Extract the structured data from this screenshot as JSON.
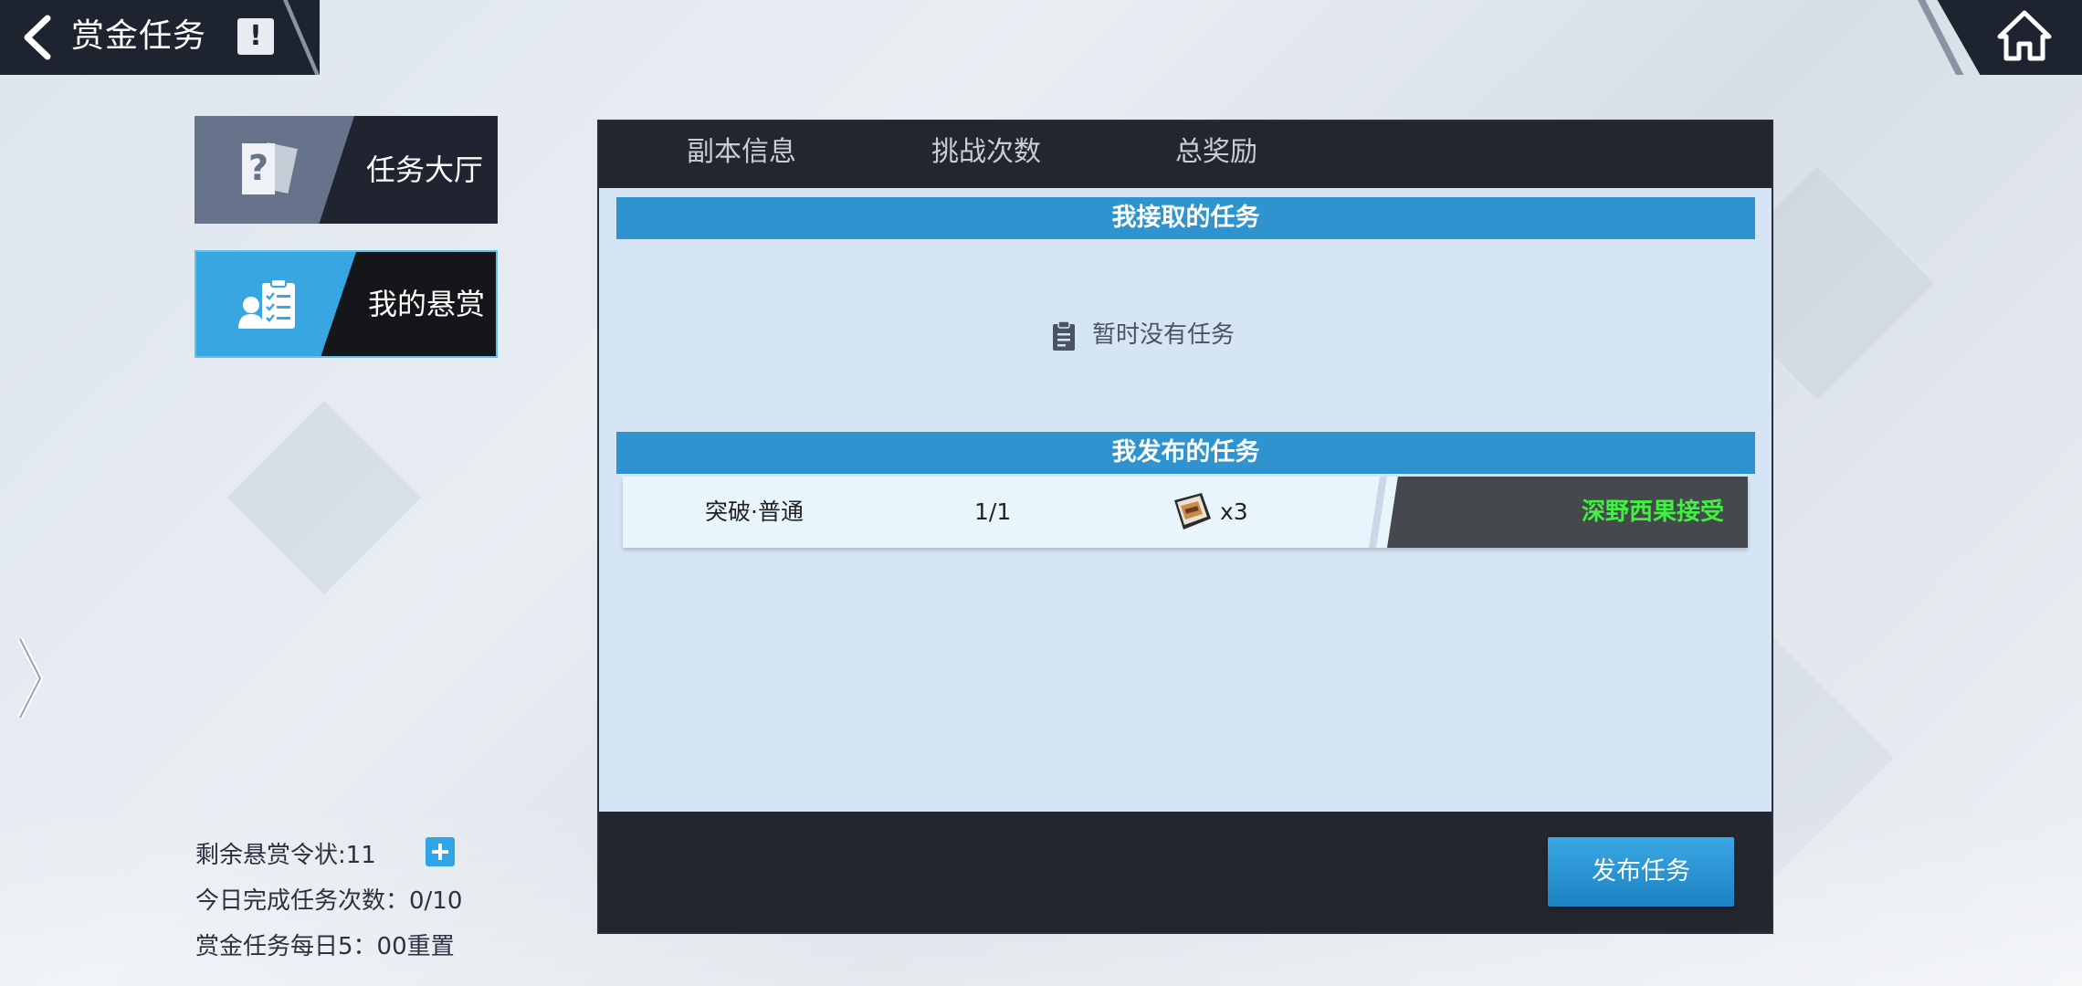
{
  "header": {
    "title": "赏金任务",
    "back_icon": "back-chevron-icon",
    "info_icon_text": "!",
    "home_icon": "home-icon"
  },
  "sidebar": {
    "items": [
      {
        "label": "任务大厅",
        "icon": "quest-board-icon",
        "active": false
      },
      {
        "label": "我的悬赏",
        "icon": "clipboard-user-icon",
        "active": true
      }
    ]
  },
  "stats": {
    "tokens_label": "剩余悬赏令状:11",
    "daily_label": "今日完成任务次数：0/10",
    "reset_label": "赏金任务每日5：00重置"
  },
  "panel": {
    "columns": [
      "副本信息",
      "挑战次数",
      "总奖励"
    ],
    "accepted_section": {
      "title": "我接取的任务",
      "empty_text": "暂时没有任务"
    },
    "published_section": {
      "title": "我发布的任务",
      "rows": [
        {
          "dungeon": "突破·普通",
          "attempts": "1/1",
          "reward_icon": "ticket-box-icon",
          "reward_qty": "x3",
          "status": "深野西果接受"
        }
      ]
    },
    "publish_button": "发布任务"
  },
  "colors": {
    "accent_blue": "#2e93cf",
    "dark": "#23262d",
    "status_green": "#3ff23f"
  }
}
